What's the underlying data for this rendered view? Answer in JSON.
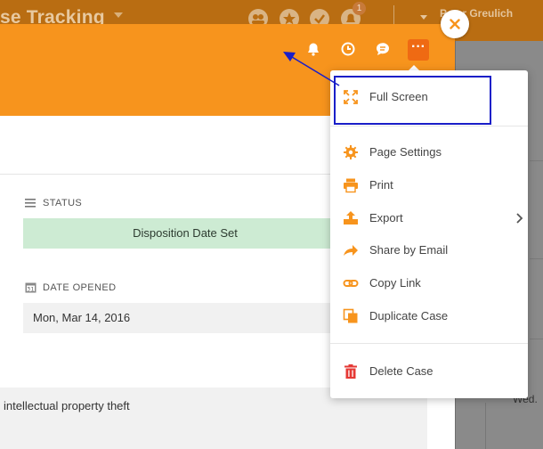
{
  "appbar": {
    "title": "se Tracking",
    "notification_count": "1",
    "user_name": "Peter Greulich"
  },
  "header": {
    "icons": [
      "bell-icon",
      "clock-icon",
      "chat-icon",
      "more-icon"
    ],
    "more_label": "···"
  },
  "fields": {
    "status_label": "STATUS",
    "status_value": "Disposition Date Set",
    "date_opened_label": "DATE OPENED",
    "date_opened_value": "Mon, Mar 14, 2016",
    "description": "intellectual property theft"
  },
  "menu": {
    "items": [
      {
        "label": "Full Screen",
        "icon": "fullscreen-icon"
      },
      {
        "label": "Page Settings",
        "icon": "gear-icon"
      },
      {
        "label": "Print",
        "icon": "printer-icon"
      },
      {
        "label": "Export",
        "icon": "export-icon"
      },
      {
        "label": "Share by Email",
        "icon": "share-arrow-icon"
      },
      {
        "label": "Copy Link",
        "icon": "link-icon"
      },
      {
        "label": "Duplicate Case",
        "icon": "duplicate-icon"
      },
      {
        "label": "Delete Case",
        "icon": "trash-icon"
      }
    ]
  },
  "backdrop": {
    "partial_text": "Wed."
  },
  "colors": {
    "accent": "#f7941d",
    "accent_dark": "#ef6a13",
    "status_green": "#cdebd3",
    "highlight_border": "#1a1fc8",
    "delete_red": "#e53935"
  }
}
